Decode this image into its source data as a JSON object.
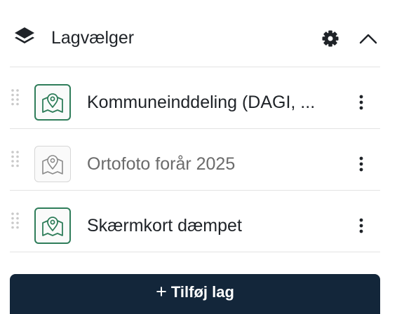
{
  "panel": {
    "title": "Lagvælger",
    "icons": {
      "header": "layers-icon",
      "settings": "gear-icon",
      "collapse": "chevron-up-icon"
    }
  },
  "layers": [
    {
      "label": "Kommuneinddeling (DAGI, ...",
      "enabled": true,
      "icon": "map-pin-icon"
    },
    {
      "label": "Ortofoto forår 2025",
      "enabled": false,
      "icon": "map-pin-icon"
    },
    {
      "label": "Skærmkort dæmpet",
      "enabled": true,
      "icon": "map-pin-icon"
    }
  ],
  "add_button": {
    "plus": "+",
    "label": "Tilføj lag"
  },
  "colors": {
    "accent": "#2f7d5a",
    "button_bg": "#13263a",
    "divider": "#e3e3e3",
    "text": "#1f2328",
    "text_dim": "#6b6b6b"
  }
}
